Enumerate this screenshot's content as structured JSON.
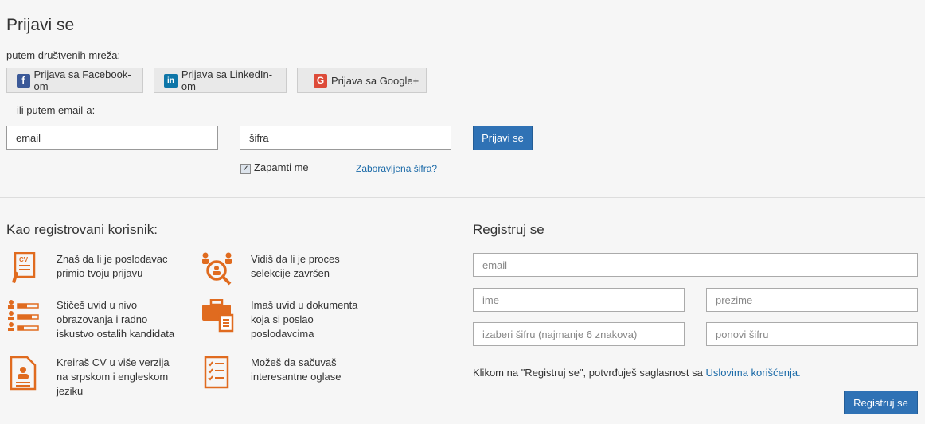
{
  "login": {
    "title": "Prijavi se",
    "social_label": "putem društvenih mreža:",
    "facebook_label": "Prijava sa Facebook-om",
    "linkedin_label": "Prijava sa LinkedIn-om",
    "google_label": "Prijava sa Google+",
    "email_label": "ili putem email-a:",
    "email_placeholder": "email",
    "password_placeholder": "šifra",
    "submit_label": "Prijavi se",
    "remember_label": "Zapamti me",
    "remember_checked": true,
    "forgot_label": "Zaboravljena šifra?"
  },
  "benefits": {
    "title": "Kao registrovani korisnik:",
    "items": [
      {
        "icon": "cv-document-icon",
        "text": [
          "Znaš da li je poslodavac",
          "primio tvoju prijavu"
        ]
      },
      {
        "icon": "selection-process-icon",
        "text": [
          "Vidiš da li je proces",
          "selekcije završen"
        ]
      },
      {
        "icon": "candidates-list-icon",
        "text": [
          "Stičeš uvid u nivo",
          "obrazovanja i radno",
          "iskustvo ostalih kandidata"
        ]
      },
      {
        "icon": "briefcase-documents-icon",
        "text": [
          "Imaš uvid u dokumenta",
          "koja si poslao",
          "poslodavcima"
        ]
      },
      {
        "icon": "cv-profile-icon",
        "text": [
          "Kreiraš CV u više verzija",
          "na srpskom i engleskom",
          "jeziku"
        ]
      },
      {
        "icon": "saved-ads-icon",
        "text": [
          "Možeš da sačuvaš",
          "interesantne oglase"
        ]
      }
    ]
  },
  "register": {
    "title": "Registruj se",
    "email_placeholder": "email",
    "first_name_placeholder": "ime",
    "last_name_placeholder": "prezime",
    "password_placeholder": "izaberi šifru (najmanje 6 znakova)",
    "repeat_password_placeholder": "ponovi šifru",
    "terms_text": "Klikom na \"Registruj se\", potvrđuješ saglasnost sa ",
    "terms_link": "Uslovima korišćenja.",
    "submit_label": "Registruj se"
  },
  "colors": {
    "accent": "#2f72b5",
    "icon_orange": "#e06b1f",
    "link": "#1a6aa8"
  }
}
